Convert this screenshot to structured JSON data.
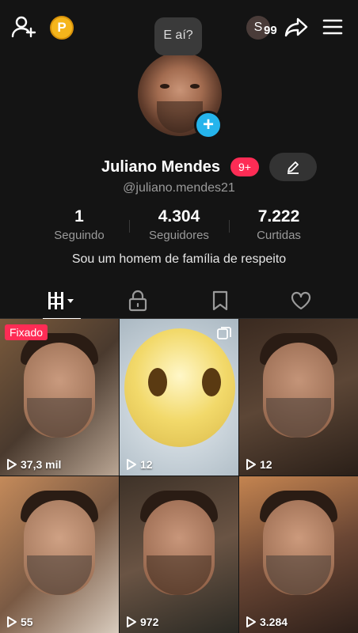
{
  "header": {
    "coin_label": "P",
    "user_badge_letter": "S",
    "user_badge_count": "99"
  },
  "status_bubble": "E aí?",
  "profile": {
    "name": "Juliano Mendes",
    "notif_badge": "9+",
    "handle": "@juliano.mendes21",
    "bio": "Sou um homem de família de respeito"
  },
  "stats": [
    {
      "value": "1",
      "label": "Seguindo"
    },
    {
      "value": "4.304",
      "label": "Seguidores"
    },
    {
      "value": "7.222",
      "label": "Curtidas"
    }
  ],
  "tabs": [
    "videos-grid-icon",
    "lock-icon",
    "bookmark-icon",
    "heart-icon"
  ],
  "videos": [
    {
      "views": "37,3 mil",
      "pinned": "Fixado"
    },
    {
      "views": "12"
    },
    {
      "views": "12"
    },
    {
      "views": "55"
    },
    {
      "views": "972"
    },
    {
      "views": "3.284"
    }
  ],
  "colors": {
    "background": "#141414",
    "accent_pink": "#fe2c55",
    "accent_blue": "#25b4ec",
    "coin": "#f5b51c"
  }
}
